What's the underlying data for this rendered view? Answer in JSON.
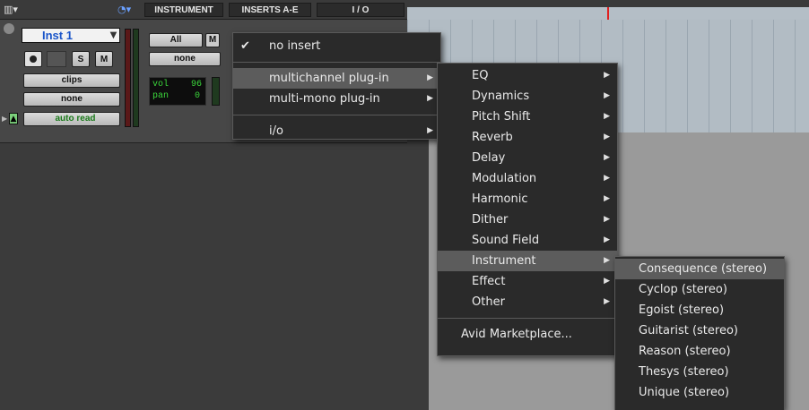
{
  "header": {
    "instrument_label": "INSTRUMENT",
    "inserts_label": "INSERTS A-E",
    "io_label": "I / O"
  },
  "track": {
    "name": "Inst 1",
    "solo_label": "S",
    "mute_label": "M",
    "playlist_label": "clips",
    "group_label": "none",
    "automation_label": "auto read",
    "midi_input_label": "All",
    "midi_input_mute": "M",
    "midi_output_label": "none",
    "vol_label": "vol",
    "vol_value": "96",
    "pan_label": "pan",
    "pan_value": "0"
  },
  "insert_menu": {
    "items": [
      {
        "label": "no insert",
        "checked": true
      },
      {
        "label": "multichannel plug-in",
        "submenu": true
      },
      {
        "label": "multi-mono plug-in",
        "submenu": true
      },
      {
        "label": "i/o",
        "submenu": true
      }
    ]
  },
  "category_menu": {
    "items": [
      "EQ",
      "Dynamics",
      "Pitch Shift",
      "Reverb",
      "Delay",
      "Modulation",
      "Harmonic",
      "Dither",
      "Sound Field",
      "Instrument",
      "Effect",
      "Other"
    ],
    "marketplace": "Avid Marketplace..."
  },
  "instrument_menu": {
    "items": [
      "Consequence (stereo)",
      "Cyclop (stereo)",
      "Egoist (stereo)",
      "Guitarist (stereo)",
      "Reason (stereo)",
      "Thesys (stereo)",
      "Unique (stereo)"
    ]
  },
  "colors": {
    "menu_bg": "#2a2a2a",
    "highlight": "#5c5c5c",
    "track_name": "#1a55c9",
    "meter_green": "#3bd63b",
    "playhead": "#e02020"
  }
}
